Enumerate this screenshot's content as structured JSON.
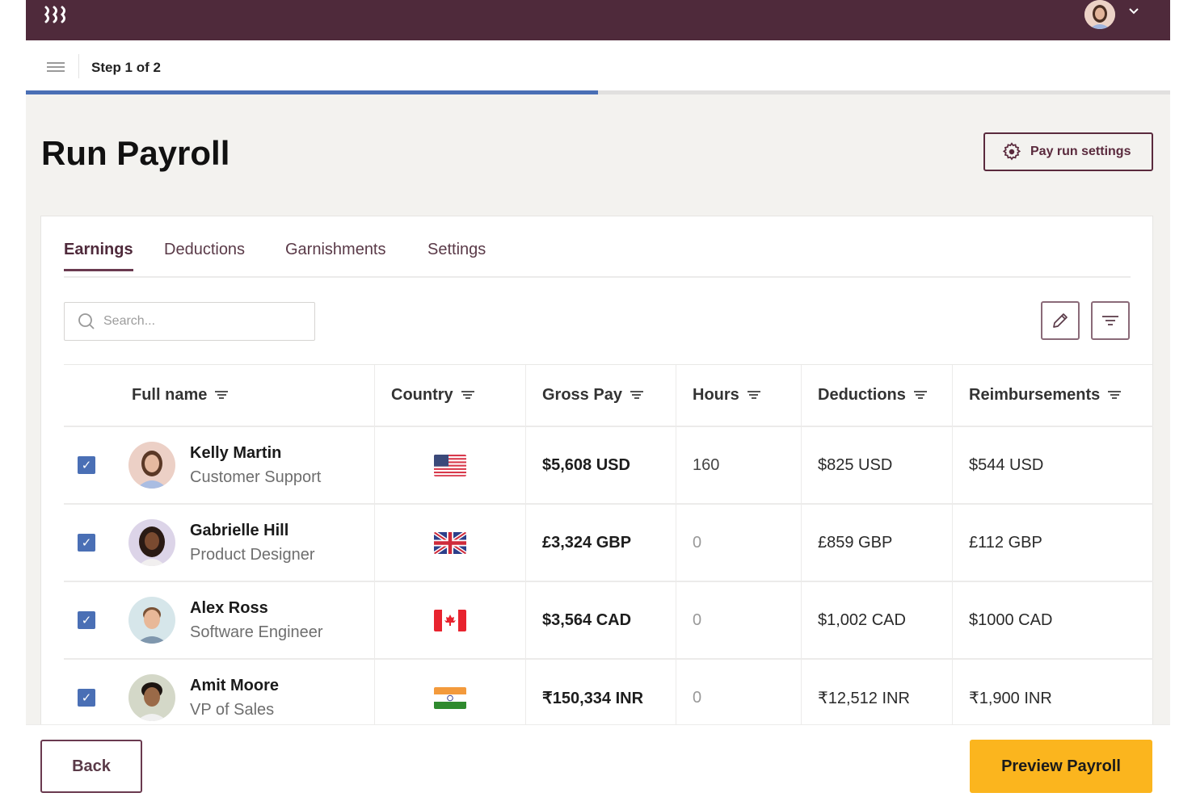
{
  "app": {
    "logo_text": "꟞",
    "logo_glyph": "⌇⌇⌇",
    "user_menu_chevron": "⌄"
  },
  "stepper": {
    "label": "Step 1 of 2",
    "progress_fraction": 0.5,
    "progress_color": "#4a6fb5"
  },
  "page": {
    "title": "Run Payroll",
    "settings_button": "Pay run settings"
  },
  "tabs": [
    {
      "label": "Earnings",
      "active": true
    },
    {
      "label": "Deductions",
      "active": false
    },
    {
      "label": "Garnishments",
      "active": false
    },
    {
      "label": "Settings",
      "active": false
    }
  ],
  "search": {
    "placeholder": "Search...",
    "value": ""
  },
  "toolbar": {
    "edit_icon": "pencil-icon",
    "filter_icon": "filter-icon"
  },
  "table": {
    "columns": [
      "Full name",
      "Country",
      "Gross Pay",
      "Hours",
      "Deductions",
      "Reimbursements"
    ],
    "rows": [
      {
        "checked": true,
        "name": "Kelly Martin",
        "role": "Customer Support",
        "country": "US",
        "gross_pay": "$5,608 USD",
        "hours": "160",
        "deductions": "$825 USD",
        "reimbursements": "$544 USD"
      },
      {
        "checked": true,
        "name": "Gabrielle Hill",
        "role": "Product Designer",
        "country": "GB",
        "gross_pay": "£3,324 GBP",
        "hours": "0",
        "deductions": "£859 GBP",
        "reimbursements": "£112 GBP"
      },
      {
        "checked": true,
        "name": "Alex Ross",
        "role": "Software Engineer",
        "country": "CA",
        "gross_pay": "$3,564 CAD",
        "hours": "0",
        "deductions": "$1,002 CAD",
        "reimbursements": "$1000 CAD"
      },
      {
        "checked": true,
        "name": "Amit Moore",
        "role": "VP of Sales",
        "country": "IN",
        "gross_pay": "₹150,334 INR",
        "hours": "0",
        "deductions": "₹12,512 INR",
        "reimbursements": "₹1,900 INR"
      }
    ]
  },
  "footer": {
    "back_label": "Back",
    "preview_label": "Preview Payroll"
  },
  "colors": {
    "brand": "#4f2a3b",
    "accent_button": "#fbb51e",
    "checkbox": "#4a6fb5"
  }
}
